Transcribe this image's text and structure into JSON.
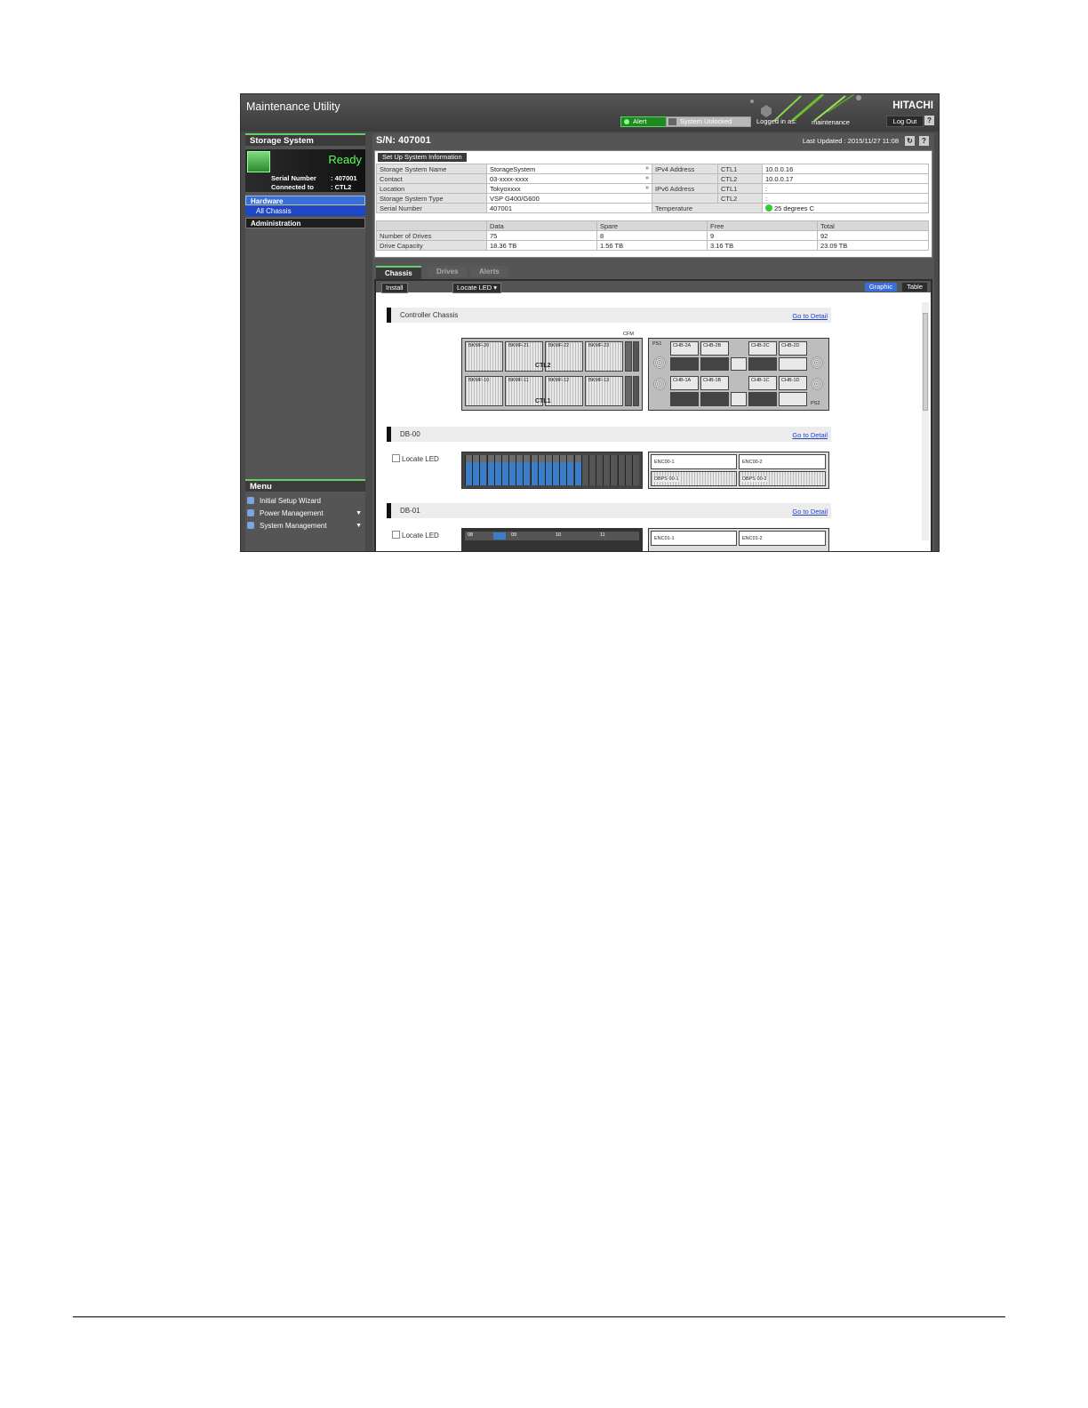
{
  "app": {
    "title": "Maintenance Utility",
    "brand": "HITACHI",
    "alert_label": "Alert",
    "unlock_label": "System Unlocked",
    "logged_label": "Logged in as:",
    "user": "maintenance",
    "logout_label": "Log Out",
    "help_label": "?"
  },
  "sidebar": {
    "title": "Storage System",
    "status": "Ready",
    "serial_label": "Serial Number",
    "serial_value": ": 407001",
    "connected_label": "Connected to",
    "connected_value": ": CTL2",
    "hardware_label": "Hardware",
    "all_chassis_label": "All Chassis",
    "administration_label": "Administration",
    "menu_title": "Menu",
    "menu_items": [
      {
        "label": "Initial Setup Wizard",
        "arrow": ""
      },
      {
        "label": "Power Management",
        "arrow": "▼"
      },
      {
        "label": "System Management",
        "arrow": "▼"
      }
    ]
  },
  "main": {
    "sn": "S/N: 407001",
    "last_updated": "Last Updated : 2015/11/27 11:08",
    "setup_button": "Set Up System Information",
    "info": {
      "storage_name_label": "Storage System Name",
      "storage_name": "StorageSystem",
      "contact_label": "Contact",
      "contact": "03-xxxx-xxxx",
      "location_label": "Location",
      "location": "Tokyoxxxx",
      "type_label": "Storage System Type",
      "type": "VSP G400/G600",
      "serial_label": "Serial Number",
      "serial": "407001",
      "ipv4_label": "IPv4 Address",
      "ipv6_label": "IPv6 Address",
      "ctl1": "CTL1",
      "ctl2": "CTL2",
      "ipv4_ctl1": "10.0.0.16",
      "ipv4_ctl2": "10.0.0.17",
      "ipv6_ctl1": ":",
      "ipv6_ctl2": ":",
      "temp_label": "Temperature",
      "temp": "25 degrees C"
    },
    "drives": {
      "headers": [
        "",
        "Data",
        "Spare",
        "Free",
        "Total"
      ],
      "rows": [
        [
          "Number of Drives",
          "75",
          "8",
          "9",
          "92"
        ],
        [
          "Drive Capacity",
          "18.36 TB",
          "1.56 TB",
          "3.16 TB",
          "23.09 TB"
        ]
      ]
    },
    "tabs": [
      "Chassis",
      "Drives",
      "Alerts"
    ],
    "toolbar": {
      "install": "Install",
      "locate_led": "Locate LED",
      "graphic": "Graphic",
      "table": "Table"
    },
    "sections": [
      {
        "title": "Controller Chassis",
        "link": "Go to Detail"
      },
      {
        "title": "DB-00",
        "link": "Go to Detail",
        "locate": "Locate LED"
      },
      {
        "title": "DB-01",
        "link": "Go to Detail",
        "locate": "Locate LED"
      }
    ],
    "cfm": "CFM",
    "ctl_labels": [
      "CTL2",
      "CTL1"
    ],
    "chb_top": [
      "CHB-2A",
      "CHB-2B",
      "CHB-2C",
      "CHB-2D"
    ],
    "chb_bottom": [
      "CHB-1A",
      "CHB-1B",
      "CHB-1C",
      "CHB-1D"
    ],
    "bkm_top": [
      "BKMF-20",
      "BKMF-21",
      "BKMF-22",
      "BKMF-23"
    ],
    "bkm_bottom": [
      "BKMF-10",
      "BKMF-11",
      "BKMF-12",
      "BKMF-13"
    ],
    "ps": [
      "PS1",
      "PS2"
    ],
    "enc_db00": [
      "ENC00-1",
      "ENC00-2"
    ],
    "dbps_db00": [
      "DBPS 00-1",
      "DBPS 00-2"
    ],
    "enc_db01": [
      "ENC01-1",
      "ENC01-2"
    ],
    "db01_slots": [
      "08",
      "09",
      "10",
      "11"
    ]
  }
}
